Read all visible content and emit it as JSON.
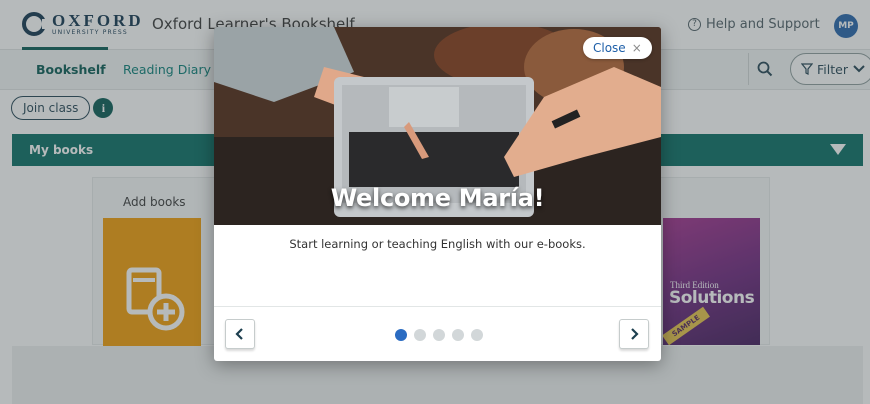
{
  "header": {
    "logo_word": "OXFORD",
    "logo_sub": "UNIVERSITY PRESS",
    "app_title": "Oxford Learner's Bookshelf",
    "help_label": "Help and Support",
    "avatar_initials": "MP"
  },
  "nav": {
    "tabs": [
      {
        "label": "Bookshelf",
        "active": true
      },
      {
        "label": "Reading Diary",
        "active": false
      }
    ],
    "filter_label": "Filter"
  },
  "join_class_label": "Join class",
  "info_glyph": "i",
  "my_books": {
    "label": "My books",
    "add_books_label": "Add books",
    "book": {
      "edition": "Third Edition",
      "title": "Solutions",
      "stamp": "SAMPLE"
    }
  },
  "modal": {
    "close_label": "Close",
    "close_glyph": "×",
    "heading": "Welcome María!",
    "body": "Start learning or teaching English with our e-books.",
    "slides_total": 5,
    "slide_active": 1
  },
  "colors": {
    "brand_teal": "#00695f",
    "accent_blue": "#2b6cc2",
    "add_tile_orange": "#f29900",
    "navy": "#0b2f4a"
  },
  "icons": [
    "help-icon",
    "search-icon",
    "filter-icon",
    "chevron-down-icon",
    "info-icon",
    "add-book-icon",
    "close-icon",
    "chevron-left-icon",
    "chevron-right-icon"
  ]
}
